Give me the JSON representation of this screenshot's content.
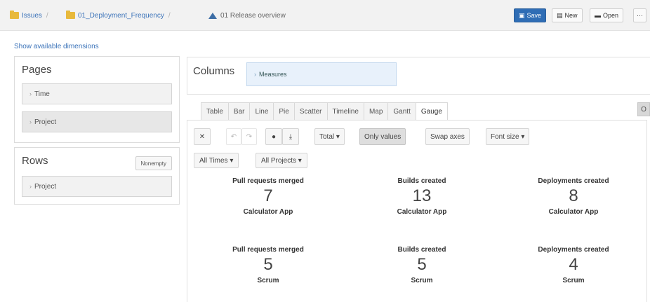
{
  "breadcrumb": {
    "items": [
      {
        "label": "Issues",
        "icon": "folder-icon"
      },
      {
        "label": "01_Deployment_Frequency",
        "icon": "folder-icon"
      },
      {
        "label": "01 Release overview",
        "icon": "report-icon"
      }
    ]
  },
  "toolbar": {
    "save_label": "Save",
    "new_label": "New",
    "open_label": "Open",
    "more_label": "···"
  },
  "show_dimensions_label": "Show available dimensions",
  "pages": {
    "title": "Pages",
    "items": [
      {
        "label": "Time"
      },
      {
        "label": "Project"
      }
    ]
  },
  "rows": {
    "title": "Rows",
    "nonempty_label": "Nonempty",
    "items": [
      {
        "label": "Project"
      }
    ]
  },
  "columns": {
    "title": "Columns",
    "measures_label": "Measures"
  },
  "tabs": [
    {
      "label": "Table"
    },
    {
      "label": "Bar"
    },
    {
      "label": "Line"
    },
    {
      "label": "Pie"
    },
    {
      "label": "Scatter"
    },
    {
      "label": "Timeline"
    },
    {
      "label": "Map"
    },
    {
      "label": "Gantt"
    },
    {
      "label": "Gauge",
      "active": true
    }
  ],
  "tab_overflow_label": "O",
  "tools": {
    "total_label": "Total ▾",
    "only_values_label": "Only values",
    "swap_axes_label": "Swap axes",
    "font_size_label": "Font size ▾"
  },
  "filters": {
    "all_times_label": "All Times ▾",
    "all_projects_label": "All Projects ▾"
  },
  "gauges": [
    {
      "measure": "Pull requests merged",
      "value": "7",
      "member": "Calculator App"
    },
    {
      "measure": "Builds created",
      "value": "13",
      "member": "Calculator App"
    },
    {
      "measure": "Deployments created",
      "value": "8",
      "member": "Calculator App"
    },
    {
      "measure": "Pull requests merged",
      "value": "5",
      "member": "Scrum"
    },
    {
      "measure": "Builds created",
      "value": "5",
      "member": "Scrum"
    },
    {
      "measure": "Deployments created",
      "value": "4",
      "member": "Scrum"
    }
  ],
  "colors": {
    "link": "#3b73b9",
    "primary_button": "#2f6db5",
    "folder": "#e8b93c",
    "measures_pill": "#e8f1fb"
  }
}
